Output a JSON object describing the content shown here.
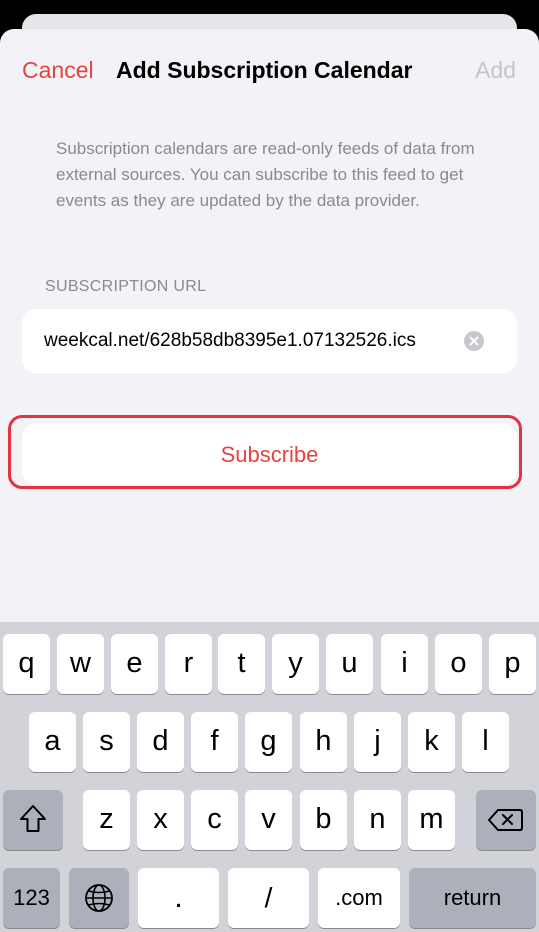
{
  "nav": {
    "cancel": "Cancel",
    "title": "Add Subscription Calendar",
    "add": "Add"
  },
  "description": "Subscription calendars are read-only feeds of data from external sources. You can subscribe to this feed to get events as they are updated by the data provider.",
  "url_section": {
    "header": "SUBSCRIPTION URL",
    "value": "weekcal.net/628b58db8395e1.07132526.ics"
  },
  "subscribe_label": "Subscribe",
  "keyboard": {
    "row1": [
      "q",
      "w",
      "e",
      "r",
      "t",
      "y",
      "u",
      "i",
      "o",
      "p"
    ],
    "row2": [
      "a",
      "s",
      "d",
      "f",
      "g",
      "h",
      "j",
      "k",
      "l"
    ],
    "row3": [
      "z",
      "x",
      "c",
      "v",
      "b",
      "n",
      "m"
    ],
    "numbers_key": "123",
    "dot_key": ".",
    "slash_key": "/",
    "dotcom_key": ".com",
    "return_key": "return"
  },
  "colors": {
    "accent": "#e5443f",
    "highlight": "#e3333f"
  }
}
